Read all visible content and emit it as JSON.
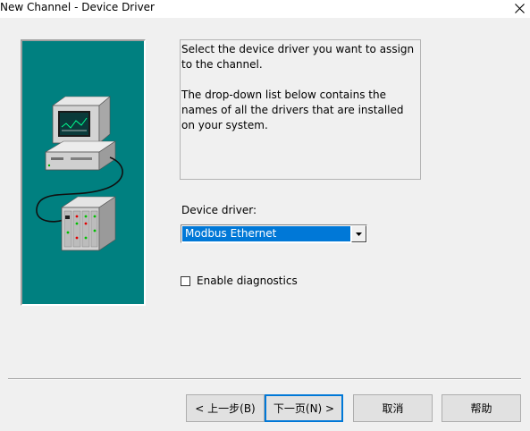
{
  "window": {
    "title": "New Channel - Device Driver",
    "close_icon": "close-icon"
  },
  "description": {
    "paragraph1": "Select the device driver you want to assign to the channel.",
    "paragraph2": "The drop-down list below contains the names of all the drivers that are installed on your system."
  },
  "device_driver": {
    "label": "Device driver:",
    "selected": "Modbus Ethernet",
    "selection_color": "#0078d7"
  },
  "diagnostics": {
    "label": "Enable diagnostics",
    "checked": false
  },
  "buttons": {
    "back": "< 上一步(B)",
    "next": "下一页(N) >",
    "cancel": "取消",
    "help": "帮助"
  },
  "colors": {
    "illustration_bg": "#008080",
    "dialog_bg": "#f0f0f0",
    "default_button_border": "#0078d7"
  }
}
